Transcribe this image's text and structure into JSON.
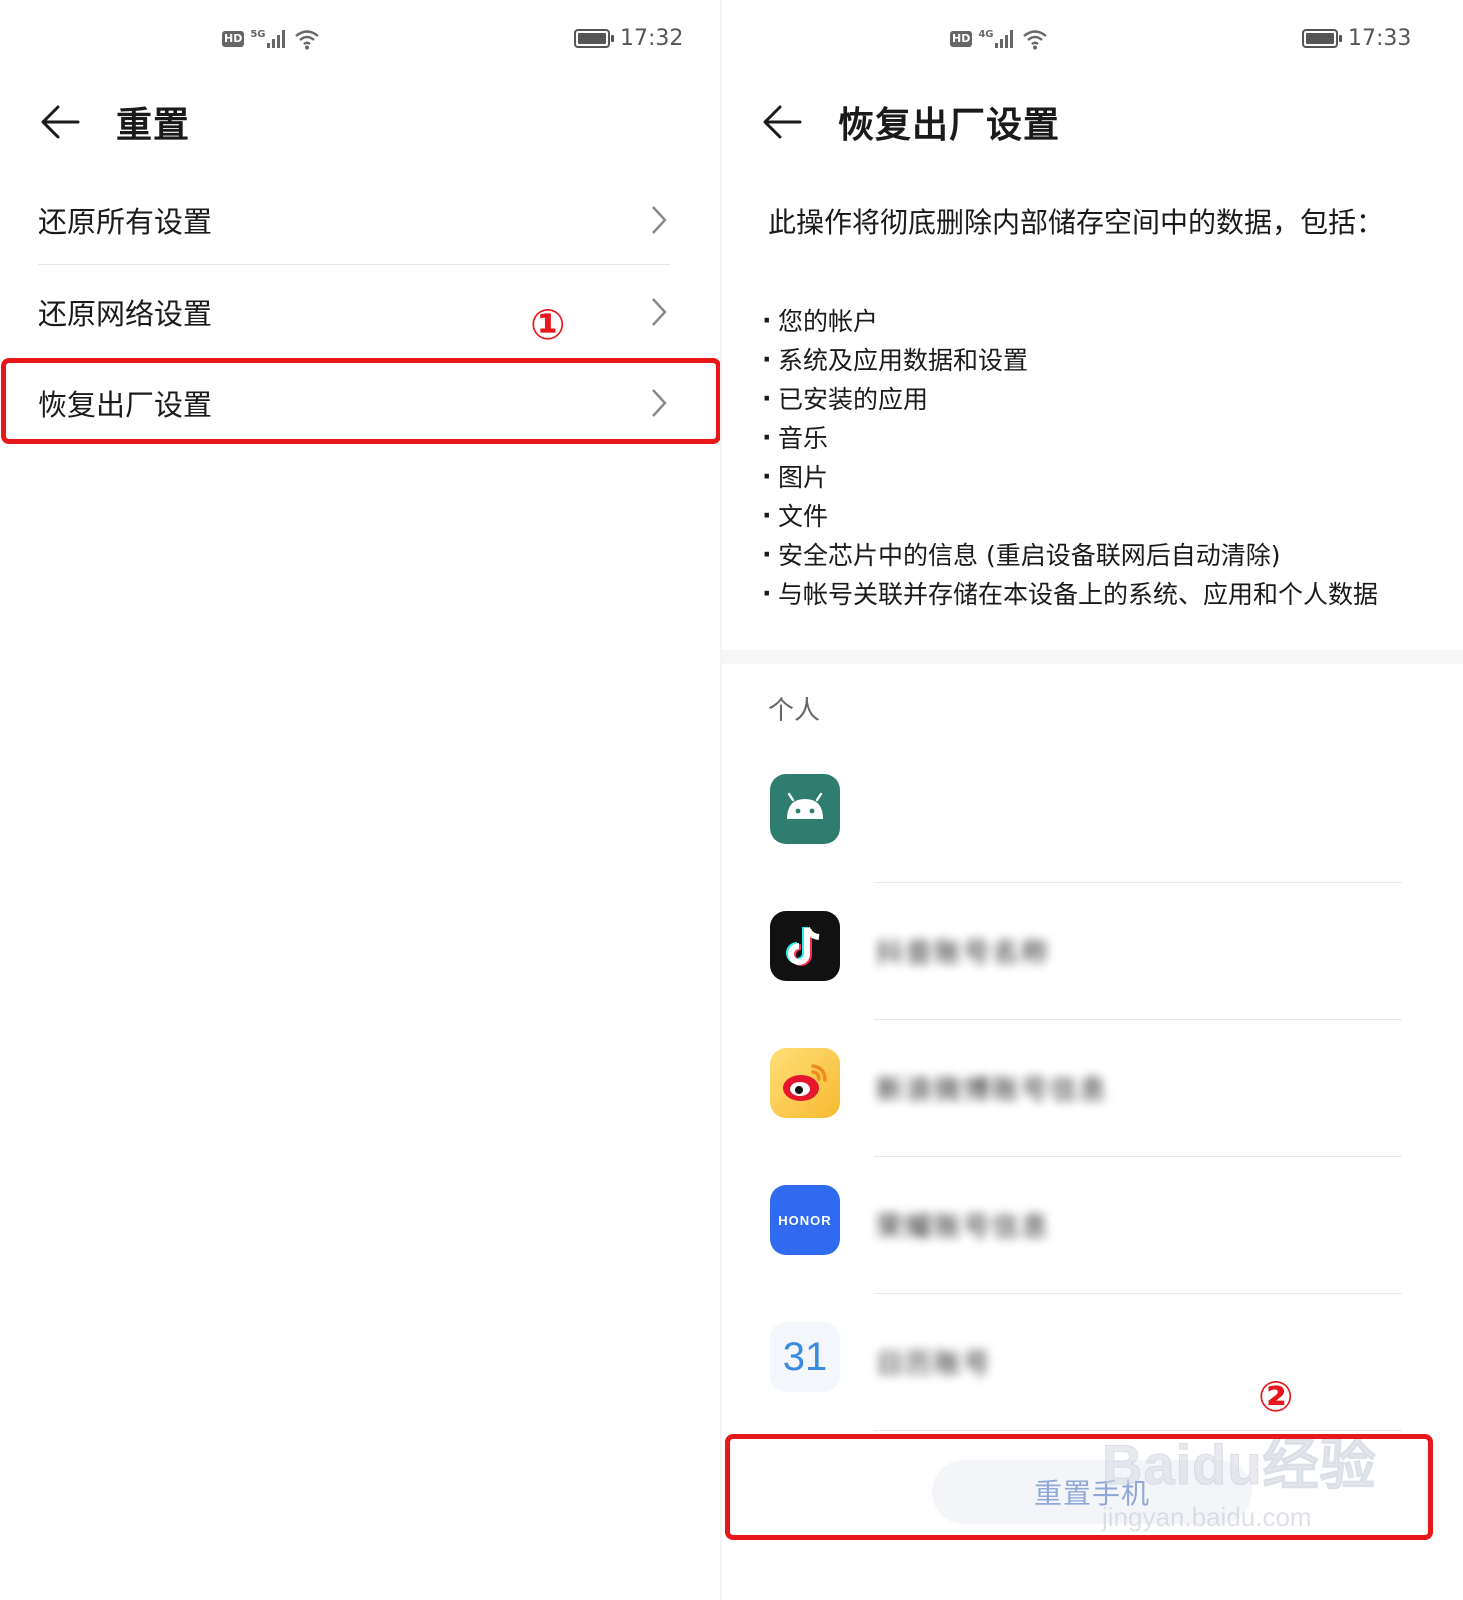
{
  "left_screen": {
    "status": {
      "time": "17:32",
      "network": "5G"
    },
    "title": "重置",
    "items": [
      {
        "label": "还原所有设置"
      },
      {
        "label": "还原网络设置"
      },
      {
        "label": "恢复出厂设置"
      }
    ],
    "annotation_marker": "①"
  },
  "right_screen": {
    "status": {
      "time": "17:33",
      "network": "4G"
    },
    "title": "恢复出厂设置",
    "description": "此操作将彻底删除内部储存空间中的数据，包括：",
    "bullets": [
      "您的帐户",
      "系统及应用数据和设置",
      "已安装的应用",
      "音乐",
      "图片",
      "文件",
      "安全芯片中的信息 (重启设备联网后自动清除)",
      "与帐号关联并存储在本设备上的系统、应用和个人数据"
    ],
    "section_header": "个人",
    "accounts": [
      {
        "icon": "android-icon",
        "name": ""
      },
      {
        "icon": "tiktok-icon",
        "name": "抖音账号名称"
      },
      {
        "icon": "weibo-icon",
        "name": "新浪微博账号信息"
      },
      {
        "icon": "honor-icon",
        "icon_text": "HONOR",
        "name": "荣耀账号信息"
      },
      {
        "icon": "calendar-icon",
        "icon_text": "31",
        "name": "日历账号"
      }
    ],
    "reset_button": "重置手机",
    "annotation_marker": "②"
  },
  "watermark": {
    "text": "Baidu经验",
    "url": "jingyan.baidu.com"
  },
  "colors": {
    "highlight": "#e8171a",
    "honor_blue": "#2f6bf0",
    "android_green": "#2e7d6e"
  }
}
